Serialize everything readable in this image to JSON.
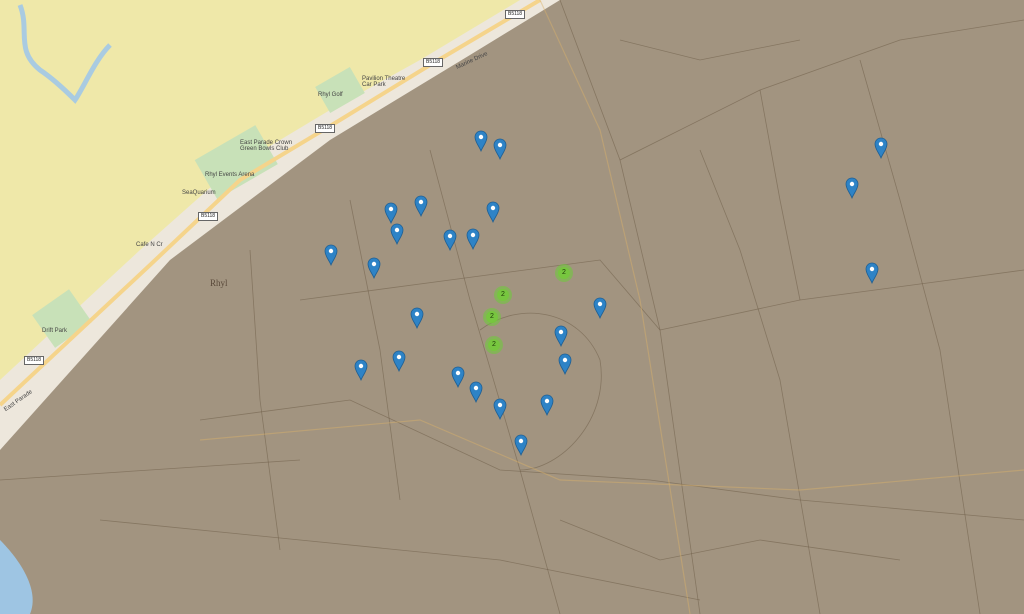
{
  "map": {
    "town_label": "Rhyl",
    "road_badges": [
      "B5118",
      "B5118",
      "B5118",
      "B5118",
      "B5118"
    ],
    "place_labels": [
      "Marine Drive",
      "Pavilion Theatre Car Park",
      "Rhyl Golf",
      "East Parade Crown Green Bowls Club",
      "Rhyl Events Arena",
      "SeaQuarium",
      "Cafe N Cr",
      "Drift Park",
      "East Parade"
    ],
    "markers_count_visible": 25,
    "clusters": [
      {
        "count": "2"
      },
      {
        "count": "2"
      },
      {
        "count": "2"
      },
      {
        "count": "2"
      }
    ],
    "colors": {
      "sea": "#efe8a9",
      "marker": "#2e83c6",
      "cluster": "#7cc63c",
      "historic_overlay": "#8d7c66"
    }
  }
}
